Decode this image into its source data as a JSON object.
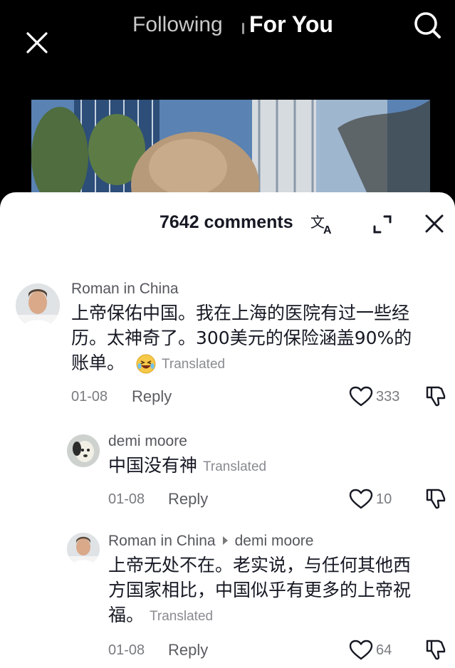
{
  "nav": {
    "tab_following": "Following",
    "tab_for_you": "For You"
  },
  "sheet": {
    "comment_count": "7642 comments"
  },
  "comments": [
    {
      "username": "Roman in China",
      "text_lines": [
        "上帝保佑中国。我在上海的医院有过一些经",
        "历。太神奇了。300美元的保险涵盖90%的",
        "账单。"
      ],
      "emoji": "grinning-squinting-face",
      "translated_label": "Translated",
      "date": "01-08",
      "reply_label": "Reply",
      "likes": "333"
    },
    {
      "username": "demi moore",
      "text_lines": [
        "中国没有神"
      ],
      "translated_label": "Translated",
      "date": "01-08",
      "reply_label": "Reply",
      "likes": "10"
    },
    {
      "username": "Roman in China",
      "reply_to": "demi moore",
      "text_lines": [
        "上帝无处不在。老实说，与任何其他西",
        "方国家相比，中国似乎有更多的上帝祝",
        "福。"
      ],
      "translated_label": "Translated",
      "date": "01-08",
      "reply_label": "Reply",
      "likes": "64"
    }
  ],
  "colors": {
    "background_top": "#000000",
    "sheet_bg": "#ffffff",
    "text_primary": "#161823",
    "text_secondary": "#7a7b80"
  }
}
